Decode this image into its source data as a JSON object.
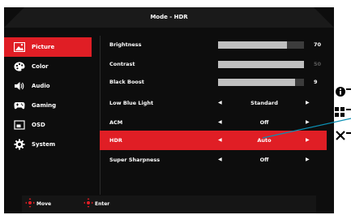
{
  "title": "Mode - HDR",
  "sidebar": {
    "items": [
      {
        "label": "Picture",
        "icon": "picture-icon",
        "active": true
      },
      {
        "label": "Color",
        "icon": "palette-icon",
        "active": false
      },
      {
        "label": "Audio",
        "icon": "speaker-icon",
        "active": false
      },
      {
        "label": "Gaming",
        "icon": "gamepad-icon",
        "active": false
      },
      {
        "label": "OSD",
        "icon": "osd-icon",
        "active": false
      },
      {
        "label": "System",
        "icon": "gear-icon",
        "active": false
      }
    ]
  },
  "settings": {
    "brightness": {
      "label": "Brightness",
      "value": "70",
      "level": 0.8
    },
    "contrast": {
      "label": "Contrast",
      "value": "50",
      "level": 1.0
    },
    "black_boost": {
      "label": "Black Boost",
      "value": "9",
      "level": 0.9
    },
    "low_blue_light": {
      "label": "Low Blue Light",
      "value": "Standard"
    },
    "acm": {
      "label": "ACM",
      "value": "Off"
    },
    "hdr": {
      "label": "HDR",
      "value": "Auto"
    },
    "super_sharpness": {
      "label": "Super Sharpness",
      "value": "Off"
    }
  },
  "footer": {
    "move_label": "Move",
    "enter_label": "Enter"
  },
  "colors": {
    "accent": "#e01e25",
    "panel": "#0d0d0d",
    "bar_fill": "#bfbfbf",
    "bar_track": "#3c3c3c"
  }
}
